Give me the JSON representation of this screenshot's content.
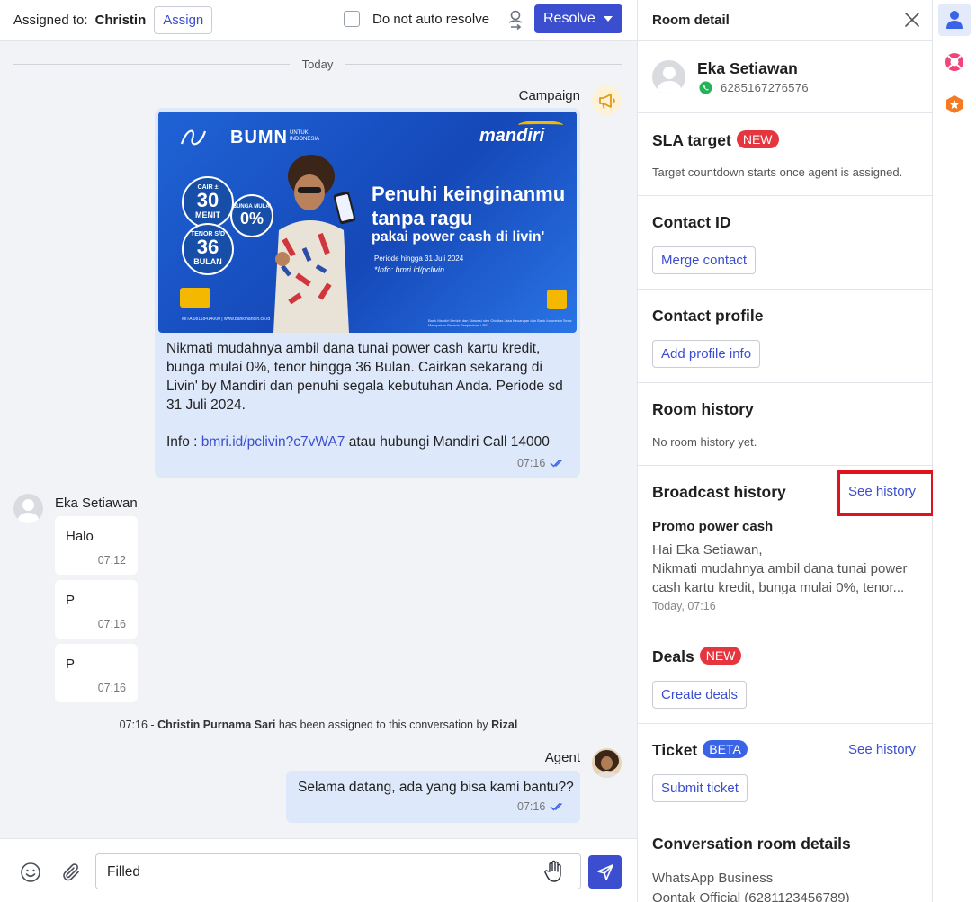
{
  "header": {
    "assigned_label": "Assigned to:",
    "assigned_name": "Christin",
    "assign_button": "Assign",
    "auto_resolve_label": "Do not auto resolve",
    "resolve_button": "Resolve"
  },
  "conversation": {
    "date_divider": "Today",
    "campaign": {
      "sender": "Campaign",
      "banner": {
        "bumn": "BUMN",
        "bumn_sub": "UNTUK INDONESIA",
        "brand": "mandiri",
        "badge1_top": "CAIR ±",
        "badge1_num": "30",
        "badge1_unit": "MENIT",
        "badge2_top": "BUNGA MULAI",
        "badge2_num": "0%",
        "badge3_top": "TENOR S/D",
        "badge3_num": "36",
        "badge3_unit": "BULAN",
        "headline1": "Penuhi keinginanmu",
        "headline2": "tanpa ragu",
        "sub": "pakai power cash di livin'",
        "period1": "Periode hingga 31 Juli 2024",
        "period2": "*Info: bmri.id/pclivin",
        "tiny_left": "MITA 08118414000 | www.bankmandiri.co.id",
        "tiny_right": "Bank Mandiri Berizin dan Diawasi oleh Otoritas Jasa Keuangan dan Bank Indonesia Serta Merupakan Peserta Penjaminan LPS"
      },
      "text": "Nikmati mudahnya ambil dana tunai power cash kartu kredit, bunga mulai 0%, tenor hingga 36 Bulan. Cairkan sekarang di Livin' by Mandiri dan penuhi segala kebutuhan Anda. Periode sd 31 Juli 2024.",
      "info_prefix": "Info : ",
      "info_link": "bmri.id/pclivin?c7vWA7",
      "info_suffix": " atau hubungi Mandiri Call 14000",
      "time": "07:16"
    },
    "customer_name": "Eka Setiawan",
    "incoming": [
      {
        "text": "Halo",
        "time": "07:12"
      },
      {
        "text": "P",
        "time": "07:16"
      },
      {
        "text": "P",
        "time": "07:16"
      }
    ],
    "system": {
      "time": "07:16 -",
      "assignee": "Christin Purnama Sari",
      "middle": "has been assigned to this conversation by",
      "assigner": "Rizal"
    },
    "agent": {
      "sender": "Agent",
      "text": "Selama datang, ada yang bisa kami bantu??",
      "time": "07:16"
    }
  },
  "composer": {
    "value": "Filled"
  },
  "room_detail": {
    "title": "Room detail",
    "contact": {
      "name": "Eka Setiawan",
      "phone": "6285167276576"
    },
    "sla": {
      "title": "SLA target",
      "badge": "NEW",
      "note": "Target countdown starts once agent is assigned."
    },
    "contact_id": {
      "title": "Contact ID",
      "button": "Merge contact"
    },
    "contact_profile": {
      "title": "Contact profile",
      "button": "Add profile info"
    },
    "room_history": {
      "title": "Room history",
      "note": "No room history yet."
    },
    "broadcast_history": {
      "title": "Broadcast history",
      "link": "See history",
      "item_title": "Promo power cash",
      "item_line1": "Hai Eka Setiawan,",
      "item_line2": "Nikmati mudahnya ambil dana tunai power",
      "item_line3": "cash kartu kredit, bunga mulai 0%, tenor...",
      "item_time": "Today, 07:16"
    },
    "deals": {
      "title": "Deals",
      "badge": "NEW",
      "button": "Create deals"
    },
    "ticket": {
      "title": "Ticket",
      "badge": "BETA",
      "link": "See history",
      "button": "Submit ticket"
    },
    "conversation_details": {
      "title": "Conversation room details",
      "channel_label": "WhatsApp Business",
      "channel_value": "Qontak Official (6281123456789)"
    }
  },
  "rail": {
    "items": [
      "user-icon",
      "lifebuoy-icon",
      "hexagon-star-icon"
    ]
  },
  "colors": {
    "primary": "#3b4ed0",
    "badge_red": "#e5363f",
    "badge_blue": "#3b63e6",
    "bubble_out": "#dde8fb",
    "chat_bg": "#f1f3f7",
    "highlight_frame": "#e0121b"
  }
}
